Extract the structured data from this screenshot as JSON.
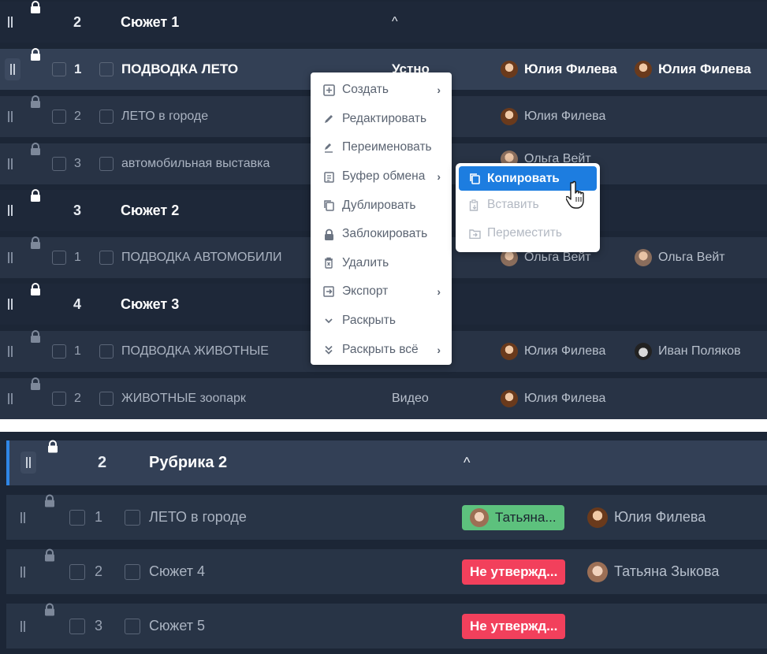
{
  "panel1": {
    "rows": [
      {
        "kind": "group",
        "num": "2",
        "title": "Сюжет 1",
        "caret": "^"
      },
      {
        "kind": "item",
        "selected": true,
        "num": "1",
        "title": "ПОДВОДКА ЛЕТО",
        "type": "Устно",
        "person1": "Юлия Филева",
        "person2": "Юлия Филева"
      },
      {
        "kind": "item",
        "num": "2",
        "title": "ЛЕТО в городе",
        "person1": "Юлия Филева"
      },
      {
        "kind": "item",
        "num": "3",
        "title": "автомобильная выставка",
        "person1": "Ольга Вейт"
      },
      {
        "kind": "group",
        "num": "3",
        "title": "Сюжет 2"
      },
      {
        "kind": "item",
        "num": "1",
        "title": "ПОДВОДКА АВТОМОБИЛИ",
        "person1": "Ольга Вейт",
        "person2": "Ольга Вейт"
      },
      {
        "kind": "group",
        "num": "4",
        "title": "Сюжет 3"
      },
      {
        "kind": "item",
        "num": "1",
        "title": "ПОДВОДКА ЖИВОТНЫЕ",
        "person1": "Юлия Филева",
        "person2": "Иван Поляков"
      },
      {
        "kind": "item",
        "num": "2",
        "title": "ЖИВОТНЫЕ зоопарк",
        "type": "Видео",
        "person1": "Юлия Филева"
      }
    ]
  },
  "context_menu": {
    "items": [
      {
        "label": "Создать",
        "icon": "plus-square-icon",
        "has_sub": true
      },
      {
        "label": "Редактировать",
        "icon": "pencil-icon"
      },
      {
        "label": "Переименовать",
        "icon": "rename-icon"
      },
      {
        "label": "Буфер обмена",
        "icon": "clipboard-icon",
        "has_sub": true
      },
      {
        "label": "Дублировать",
        "icon": "duplicate-icon"
      },
      {
        "label": "Заблокировать",
        "icon": "lock-icon"
      },
      {
        "label": "Удалить",
        "icon": "trash-icon"
      },
      {
        "label": "Экспорт",
        "icon": "export-icon",
        "has_sub": true
      },
      {
        "label": "Раскрыть",
        "icon": "chevron-down-icon"
      },
      {
        "label": "Раскрыть всё",
        "icon": "double-chevron-down-icon",
        "has_sub": true
      }
    ]
  },
  "sub_menu": {
    "items": [
      {
        "label": "Копировать",
        "icon": "copy-icon",
        "active": true
      },
      {
        "label": "Вставить",
        "icon": "paste-icon"
      },
      {
        "label": "Переместить",
        "icon": "move-icon"
      }
    ]
  },
  "panel2": {
    "group": {
      "num": "2",
      "title": "Рубрика 2",
      "caret": "^"
    },
    "rows": [
      {
        "num": "1",
        "title": "ЛЕТО в городе",
        "badge": "Татьяна...",
        "badge_color": "#5dc17d",
        "person": "Юлия Филева"
      },
      {
        "num": "2",
        "title": "Сюжет 4",
        "badge": "Не утвержд...",
        "badge_color": "#f2405c",
        "person": "Татьяна Зыкова"
      },
      {
        "num": "3",
        "title": "Сюжет 5",
        "badge": "Не утвержд...",
        "badge_color": "#f2405c"
      }
    ]
  },
  "colors": {
    "accent": "#1d7de0",
    "background": "#1c2636",
    "row": "#283345"
  }
}
